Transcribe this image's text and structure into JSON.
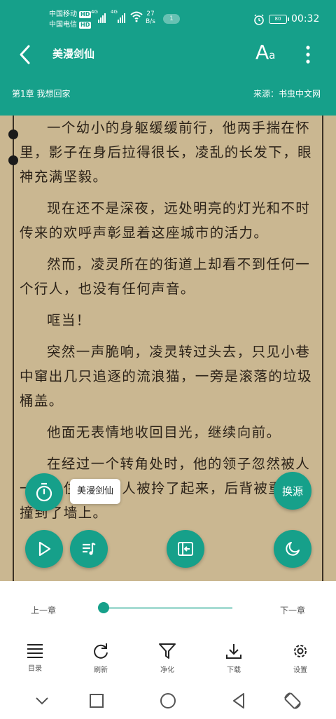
{
  "status_bar": {
    "carrier1": "中国移动",
    "carrier2": "中国电信",
    "hd1": "HD",
    "hd2": "HD",
    "net1": "4G",
    "net2": "4G",
    "speed_value": "27",
    "speed_unit": "B/s",
    "notification_count": "1",
    "battery": "80",
    "time": "00:32"
  },
  "app_bar": {
    "book_title": "美漫剑仙",
    "font_main": "A",
    "font_sub": "a",
    "chapter": "第1章 我想回家",
    "source": "来源：书虫中文网"
  },
  "content": {
    "paragraphs": [
      {
        "text": "一个幼小的身躯缓缓前行，他两手揣在怀里，影子在身后拉得很长，凌乱的长发下，眼神充满坚毅。",
        "indent": true
      },
      {
        "text": "现在还不是深夜，远处明亮的灯光和不时传来的欢呼声彰显着这座城市的活力。",
        "indent": true
      },
      {
        "text": "然而，凌灵所在的街道上却看不到任何一个行人，也没有任何声音。",
        "indent": true
      },
      {
        "text": "哐当！",
        "indent": true
      },
      {
        "text": "突然一声脆响，凌灵转过头去，只见小巷中窜出几只追逐的流浪猫，一旁是滚落的垃圾桶盖。",
        "indent": true
      },
      {
        "text": "他面无表情地收回目光，继续向前。",
        "indent": true
      },
      {
        "text": "在经过一个转角处时，他的领子忽然被人一把拎住，整个人被拎了起来，后背被重重地撞到了墙上。",
        "indent": true
      }
    ]
  },
  "overlay": {
    "title_chip": "美漫剑仙",
    "change_source": "换源"
  },
  "bottom": {
    "prev_chapter": "上一章",
    "next_chapter": "下一章",
    "progress": 0.0,
    "tools": [
      "目录",
      "刷新",
      "净化",
      "下载",
      "设置"
    ]
  },
  "colors": {
    "accent": "#16a08a",
    "paper": "#cab791",
    "ink": "#2b2218"
  }
}
